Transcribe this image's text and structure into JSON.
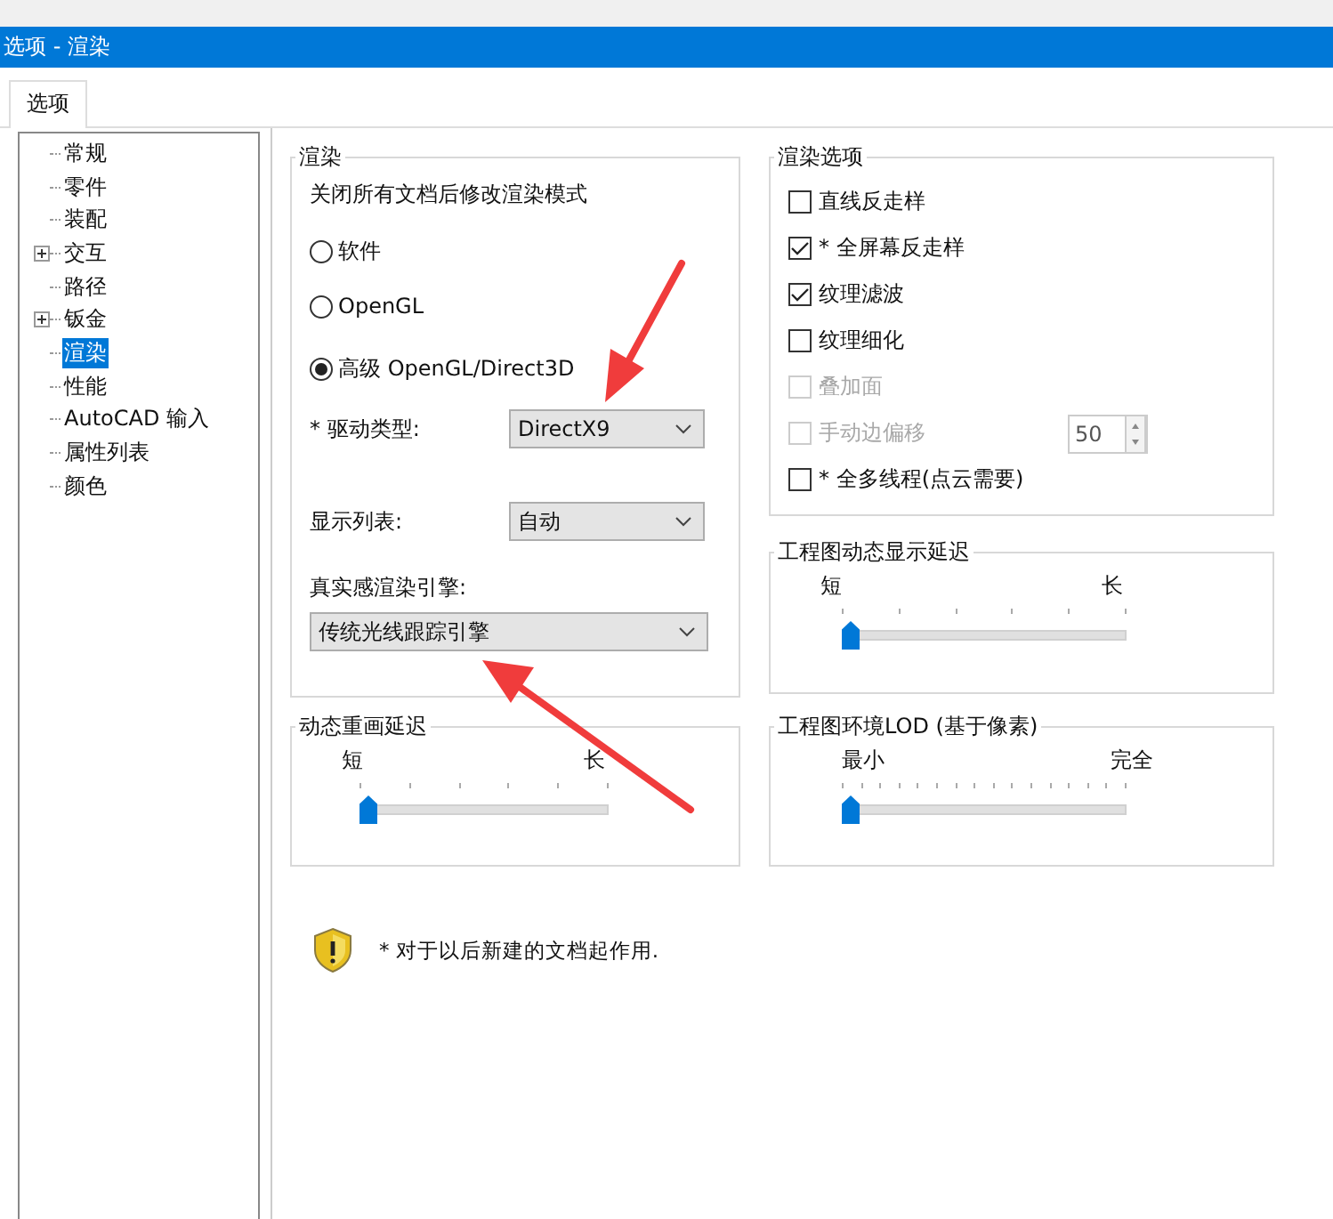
{
  "window": {
    "title": "选项 - 渲染"
  },
  "tabs": [
    {
      "label": "选项",
      "selected": true
    }
  ],
  "tree": {
    "items": [
      {
        "label": "常规",
        "selected": false,
        "kind": "leaf"
      },
      {
        "label": "零件",
        "selected": false,
        "kind": "leaf"
      },
      {
        "label": "装配",
        "selected": false,
        "kind": "leaf"
      },
      {
        "label": "交互",
        "selected": false,
        "kind": "collapsed"
      },
      {
        "label": "路径",
        "selected": false,
        "kind": "leaf"
      },
      {
        "label": "钣金",
        "selected": false,
        "kind": "collapsed"
      },
      {
        "label": "渲染",
        "selected": true,
        "kind": "leaf"
      },
      {
        "label": "性能",
        "selected": false,
        "kind": "leaf"
      },
      {
        "label": "AutoCAD 输入",
        "selected": false,
        "kind": "leaf"
      },
      {
        "label": "属性列表",
        "selected": false,
        "kind": "leaf"
      },
      {
        "label": "颜色",
        "selected": false,
        "kind": "leaf"
      }
    ]
  },
  "render": {
    "title": "渲染",
    "note": "关闭所有文档后修改渲染模式",
    "radios": [
      {
        "label": "软件",
        "selected": false
      },
      {
        "label": "OpenGL",
        "selected": false
      },
      {
        "label": "高级 OpenGL/Direct3D",
        "selected": true
      }
    ],
    "fields": [
      {
        "label": "* 驱动类型:",
        "value": "DirectX9",
        "kind": "inline"
      },
      {
        "label": "显示列表:",
        "value": "自动",
        "kind": "inline"
      },
      {
        "label": "真实感渲染引擎:",
        "value": "传统光线跟踪引擎",
        "kind": "stacked"
      }
    ]
  },
  "render_options": {
    "title": "渲染选项",
    "items": [
      {
        "label": "直线反走样",
        "checked": false,
        "disabled": false,
        "kind": "check"
      },
      {
        "label": "* 全屏幕反走样",
        "checked": true,
        "disabled": false,
        "kind": "check"
      },
      {
        "label": "纹理滤波",
        "checked": true,
        "disabled": false,
        "kind": "check"
      },
      {
        "label": "纹理细化",
        "checked": false,
        "disabled": false,
        "kind": "check"
      },
      {
        "label": "叠加面",
        "checked": false,
        "disabled": true,
        "kind": "check"
      },
      {
        "label": "手动边偏移",
        "checked": false,
        "disabled": true,
        "kind": "spin",
        "value": "50"
      },
      {
        "label": "* 全多线程(点云需要)",
        "checked": false,
        "disabled": false,
        "kind": "check"
      }
    ]
  },
  "sliders": [
    {
      "title": "工程图动态显示延迟",
      "min_label": "短",
      "max_label": "长",
      "level": 0
    },
    {
      "title": "动态重画延迟",
      "min_label": "短",
      "max_label": "长",
      "level": 0
    },
    {
      "title": "工程图环境LOD (基于像素)",
      "min_label": "最小",
      "max_label": "完全",
      "level": 0
    }
  ],
  "footer_note": "* 对于以后新建的文档起作用."
}
